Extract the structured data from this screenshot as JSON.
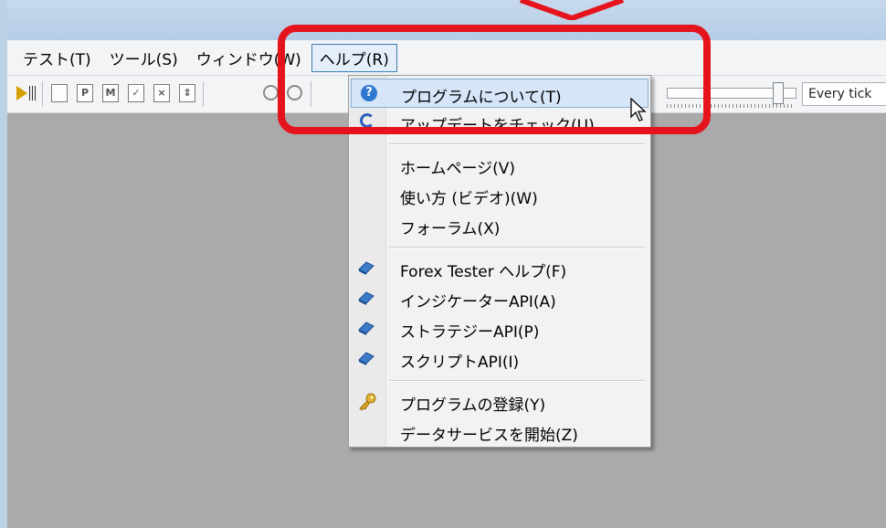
{
  "menu_bar": {
    "items": [
      "テスト(T)",
      "ツール(S)",
      "ウィンドウ(W)",
      "ヘルプ(R)"
    ],
    "active_index": 3
  },
  "toolbar": {
    "tick_mode": "Every tick",
    "speed_slider": 0.85
  },
  "help_menu": {
    "items": [
      {
        "label": "プログラムについて(T)",
        "icon": "help-icon",
        "highlighted": true
      },
      {
        "label": "アップデートをチェック(U)",
        "icon": "update-icon"
      },
      {
        "label": "ホームページ(V)",
        "icon": ""
      },
      {
        "label": "使い方 (ビデオ)(W)",
        "icon": ""
      },
      {
        "label": "フォーラム(X)",
        "icon": ""
      },
      {
        "label": "Forex Tester ヘルプ(F)",
        "icon": "book-icon"
      },
      {
        "label": "インジケーターAPI(A)",
        "icon": "book-icon"
      },
      {
        "label": "ストラテジーAPI(P)",
        "icon": "book-icon"
      },
      {
        "label": "スクリプトAPI(I)",
        "icon": "book-icon"
      },
      {
        "label": "プログラムの登録(Y)",
        "icon": "key-icon"
      },
      {
        "label": "データサービスを開始(Z)",
        "icon": ""
      }
    ]
  },
  "colors": {
    "highlight_frame": "#e5131b",
    "workspace": "#aaaaaa",
    "menu_highlight": "#d6e6f8"
  }
}
